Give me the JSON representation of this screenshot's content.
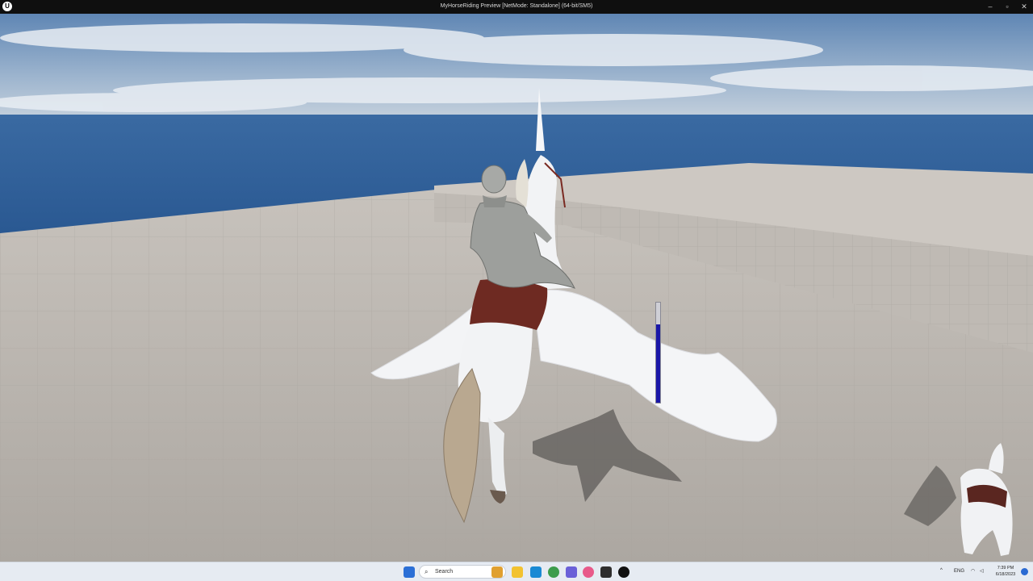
{
  "window": {
    "title": "MyHorseRiding Preview [NetMode: Standalone]  (64-bit/SM5)",
    "logo": "U",
    "controls": {
      "minimize": "–",
      "maximize": "▫",
      "close": "✕"
    }
  },
  "hud": {
    "stamina_gauge": {
      "level_percent": 78,
      "fill_color": "#1a17a8"
    }
  },
  "taskbar": {
    "search_placeholder": "Search",
    "apps": [
      "start-icon",
      "widget-icon",
      "file-explorer-icon",
      "edge-icon",
      "chrome-icon",
      "discord-icon",
      "itunes-icon",
      "nvidia-icon",
      "unreal-engine-icon"
    ],
    "tray": {
      "chevron": "^",
      "language": "ENG"
    },
    "clock": {
      "time": "7:39 PM",
      "date": "6/18/2023"
    }
  },
  "colors": {
    "sky_top": "#5f86b4",
    "ocean": "#2c5a94",
    "floor": "#bdb8b2",
    "wall": "#c5c0ba",
    "horse": "#f2f3f5",
    "saddle": "#6e2a22",
    "armor": "#9d9f9c"
  }
}
